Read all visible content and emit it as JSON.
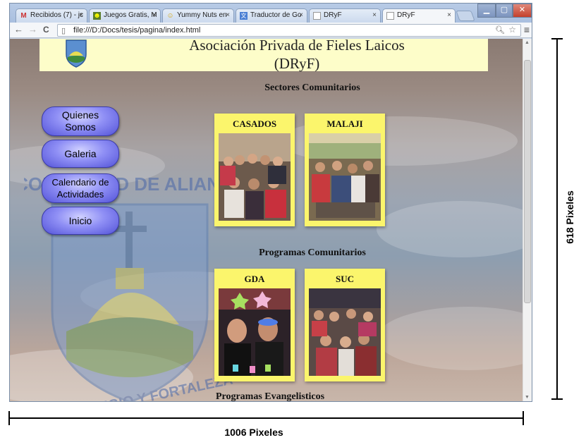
{
  "browser": {
    "tabs": [
      {
        "label": "Recibidos (7) - jc",
        "icon": "gmail-icon"
      },
      {
        "label": "Juegos Gratis, M",
        "icon": "game-icon"
      },
      {
        "label": "Yummy Nuts en",
        "icon": "smiley-icon"
      },
      {
        "label": "Traductor de Go",
        "icon": "translate-icon"
      },
      {
        "label": "DRyF",
        "icon": "page-icon"
      },
      {
        "label": "DRyF",
        "icon": "page-icon"
      }
    ],
    "url": "file:///D:/Docs/tesis/pagina/index.html",
    "back_glyph": "←",
    "forward_glyph": "→",
    "reload_glyph": "C",
    "menu_glyph": "≡"
  },
  "page": {
    "title_line1": "Asociación Privada de Fieles Laicos",
    "title_line2": "(DRyF)",
    "sections": {
      "comunitarios": "Sectores Comunitarios",
      "programas": "Programas Comunitarios",
      "evangelisticos": "Programas Evangelisticos"
    },
    "nav": [
      {
        "label_line1": "Quienes",
        "label_line2": "Somos"
      },
      {
        "label_line1": "Galeria",
        "label_line2": ""
      },
      {
        "label_line1": "Calendario de",
        "label_line2": "Actividades"
      },
      {
        "label_line1": "Inicio",
        "label_line2": ""
      }
    ],
    "cards": [
      {
        "label": "CASADOS"
      },
      {
        "label": "MALAJI"
      },
      {
        "label": "GDA"
      },
      {
        "label": "SUC"
      }
    ],
    "watermark_top": "COMUNIDAD DE ALIANZA",
    "watermark_bottom": "DIOS, REFUGIO Y FORTALEZA"
  },
  "annotations": {
    "height_label": "618 Pixeles",
    "width_label": "1006 Pixeles"
  },
  "colors": {
    "header_bg": "#fdfdc9",
    "card_bg": "#fbf56c",
    "nav_button": "#6b6be8"
  }
}
